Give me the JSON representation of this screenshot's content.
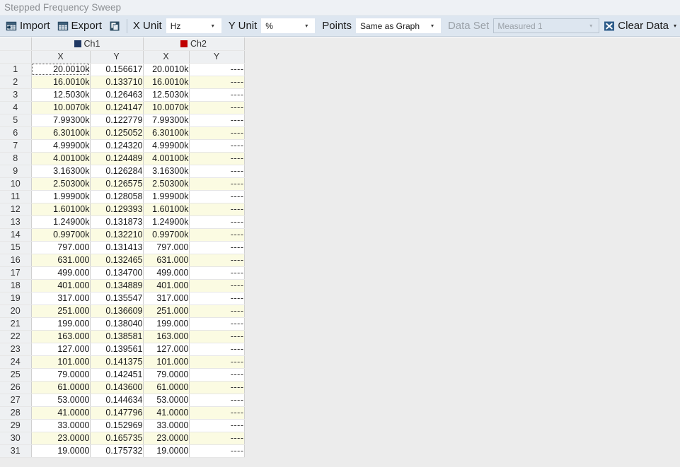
{
  "window": {
    "title": "Stepped Frequency Sweep"
  },
  "toolbar": {
    "import_label": "Import",
    "import_icon": "import-table-icon",
    "export_label": "Export",
    "export_icon": "export-table-icon",
    "copy_icon": "copy-pages-icon",
    "x_unit_label": "X Unit",
    "x_unit_value": "Hz",
    "y_unit_label": "Y Unit",
    "y_unit_value": "%",
    "points_label": "Points",
    "points_value": "Same as Graph",
    "data_set_label": "Data Set",
    "data_set_value": "Measured 1",
    "data_set_disabled": true,
    "clear_data_label": "Clear Data",
    "clear_data_icon": "clear-data-x-icon",
    "dropdown_caret": "▾",
    "combo_caret": "▾"
  },
  "table": {
    "corner_header": "",
    "channels": [
      {
        "name": "Ch1",
        "color": "#1F3864"
      },
      {
        "name": "Ch2",
        "color": "#C00000"
      }
    ],
    "sub_headers": [
      "X",
      "Y",
      "X",
      "Y"
    ],
    "rows": [
      {
        "n": "1",
        "x1": "20.0010k",
        "y1": "0.156617",
        "x2": "20.0010k",
        "y2": "----"
      },
      {
        "n": "2",
        "x1": "16.0010k",
        "y1": "0.133710",
        "x2": "16.0010k",
        "y2": "----"
      },
      {
        "n": "3",
        "x1": "12.5030k",
        "y1": "0.126463",
        "x2": "12.5030k",
        "y2": "----"
      },
      {
        "n": "4",
        "x1": "10.0070k",
        "y1": "0.124147",
        "x2": "10.0070k",
        "y2": "----"
      },
      {
        "n": "5",
        "x1": "7.99300k",
        "y1": "0.122779",
        "x2": "7.99300k",
        "y2": "----"
      },
      {
        "n": "6",
        "x1": "6.30100k",
        "y1": "0.125052",
        "x2": "6.30100k",
        "y2": "----"
      },
      {
        "n": "7",
        "x1": "4.99900k",
        "y1": "0.124320",
        "x2": "4.99900k",
        "y2": "----"
      },
      {
        "n": "8",
        "x1": "4.00100k",
        "y1": "0.124489",
        "x2": "4.00100k",
        "y2": "----"
      },
      {
        "n": "9",
        "x1": "3.16300k",
        "y1": "0.126284",
        "x2": "3.16300k",
        "y2": "----"
      },
      {
        "n": "10",
        "x1": "2.50300k",
        "y1": "0.126575",
        "x2": "2.50300k",
        "y2": "----"
      },
      {
        "n": "11",
        "x1": "1.99900k",
        "y1": "0.128058",
        "x2": "1.99900k",
        "y2": "----"
      },
      {
        "n": "12",
        "x1": "1.60100k",
        "y1": "0.129393",
        "x2": "1.60100k",
        "y2": "----"
      },
      {
        "n": "13",
        "x1": "1.24900k",
        "y1": "0.131873",
        "x2": "1.24900k",
        "y2": "----"
      },
      {
        "n": "14",
        "x1": "0.99700k",
        "y1": "0.132210",
        "x2": "0.99700k",
        "y2": "----"
      },
      {
        "n": "15",
        "x1": "797.000",
        "y1": "0.131413",
        "x2": "797.000",
        "y2": "----"
      },
      {
        "n": "16",
        "x1": "631.000",
        "y1": "0.132465",
        "x2": "631.000",
        "y2": "----"
      },
      {
        "n": "17",
        "x1": "499.000",
        "y1": "0.134700",
        "x2": "499.000",
        "y2": "----"
      },
      {
        "n": "18",
        "x1": "401.000",
        "y1": "0.134889",
        "x2": "401.000",
        "y2": "----"
      },
      {
        "n": "19",
        "x1": "317.000",
        "y1": "0.135547",
        "x2": "317.000",
        "y2": "----"
      },
      {
        "n": "20",
        "x1": "251.000",
        "y1": "0.136609",
        "x2": "251.000",
        "y2": "----"
      },
      {
        "n": "21",
        "x1": "199.000",
        "y1": "0.138040",
        "x2": "199.000",
        "y2": "----"
      },
      {
        "n": "22",
        "x1": "163.000",
        "y1": "0.138581",
        "x2": "163.000",
        "y2": "----"
      },
      {
        "n": "23",
        "x1": "127.000",
        "y1": "0.139561",
        "x2": "127.000",
        "y2": "----"
      },
      {
        "n": "24",
        "x1": "101.000",
        "y1": "0.141375",
        "x2": "101.000",
        "y2": "----"
      },
      {
        "n": "25",
        "x1": "79.0000",
        "y1": "0.142451",
        "x2": "79.0000",
        "y2": "----"
      },
      {
        "n": "26",
        "x1": "61.0000",
        "y1": "0.143600",
        "x2": "61.0000",
        "y2": "----"
      },
      {
        "n": "27",
        "x1": "53.0000",
        "y1": "0.144634",
        "x2": "53.0000",
        "y2": "----"
      },
      {
        "n": "28",
        "x1": "41.0000",
        "y1": "0.147796",
        "x2": "41.0000",
        "y2": "----"
      },
      {
        "n": "29",
        "x1": "33.0000",
        "y1": "0.152969",
        "x2": "33.0000",
        "y2": "----"
      },
      {
        "n": "30",
        "x1": "23.0000",
        "y1": "0.165735",
        "x2": "23.0000",
        "y2": "----"
      },
      {
        "n": "31",
        "x1": "19.0000",
        "y1": "0.175732",
        "x2": "19.0000",
        "y2": "----"
      }
    ]
  },
  "colors": {
    "toolbar_bg": "#DDE6F0",
    "titlebar_bg": "#EEF1F5",
    "header_bg": "#EEF0F2",
    "alt_row_bg": "#FBFBE2",
    "ch1": "#1F3864",
    "ch2": "#C00000",
    "clear_icon_bg": "#2E5C8A"
  }
}
